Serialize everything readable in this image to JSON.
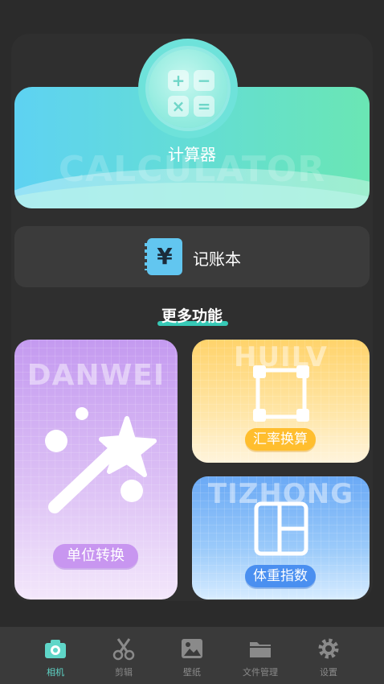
{
  "calculator": {
    "title": "计算器",
    "watermark": "CALCULATOR",
    "glyphs": [
      "+",
      "−",
      "×",
      "="
    ]
  },
  "ledger": {
    "label": "记账本",
    "icon_glyph": "¥",
    "icon": "ledger-book-icon"
  },
  "section": {
    "title": "更多功能"
  },
  "features": {
    "unit": {
      "label": "单位转换",
      "watermark": "DANWEI",
      "icon": "magic-wand-icon"
    },
    "rate": {
      "label": "汇率换算",
      "watermark": "HUILV",
      "icon": "frame-icon"
    },
    "weight": {
      "label": "体重指数",
      "watermark": "TIZHONG",
      "icon": "layout-icon"
    }
  },
  "nav": {
    "items": [
      {
        "label": "相机",
        "icon": "camera-icon",
        "active": true
      },
      {
        "label": "剪辑",
        "icon": "scissors-icon",
        "active": false
      },
      {
        "label": "壁纸",
        "icon": "image-icon",
        "active": false
      },
      {
        "label": "文件管理",
        "icon": "folder-icon",
        "active": false
      },
      {
        "label": "设置",
        "icon": "gear-icon",
        "active": false
      }
    ]
  },
  "colors": {
    "background": "#2b2b2b",
    "accent": "#5fd6c8",
    "nav_inactive": "#8a8a8a"
  }
}
